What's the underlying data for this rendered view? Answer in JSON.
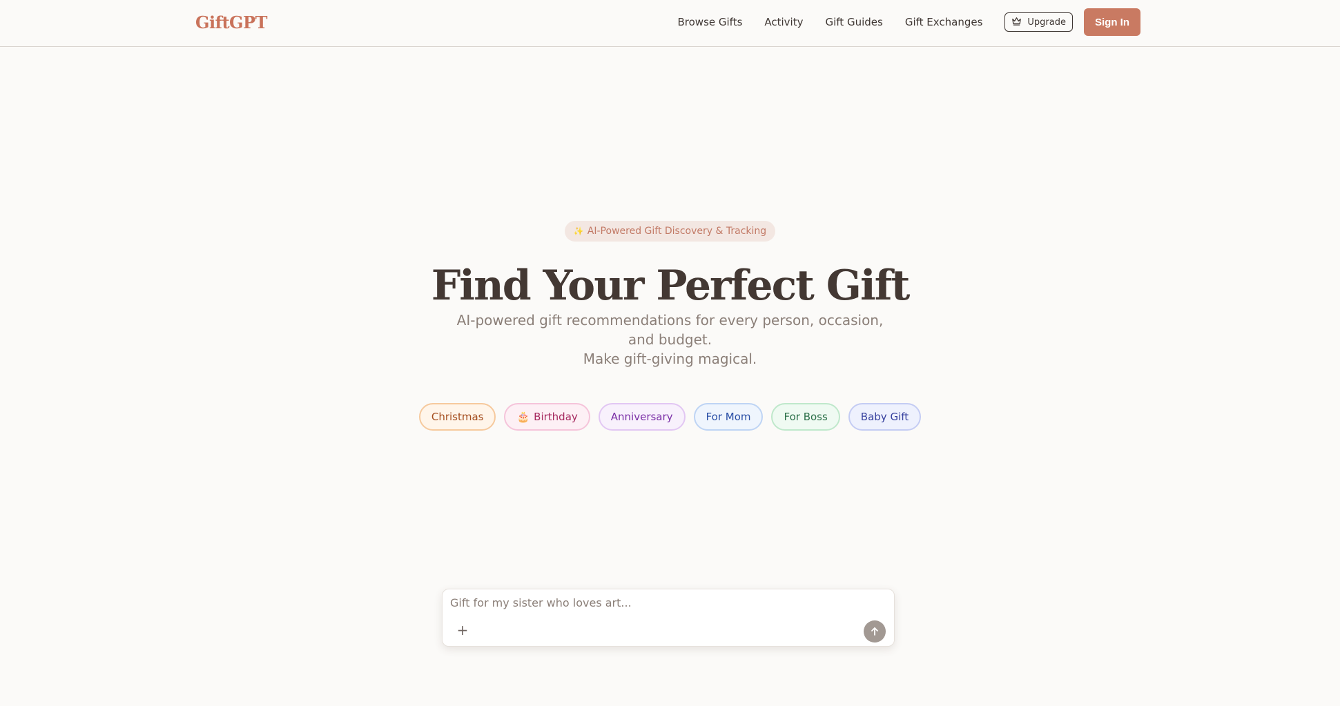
{
  "brand": {
    "name": "GiftGPT",
    "color": "#c9725a"
  },
  "nav": {
    "links": [
      "Browse Gifts",
      "Activity",
      "Gift Guides",
      "Gift Exchanges"
    ],
    "upgrade_label": "Upgrade",
    "upgrade_icon": "crown-icon",
    "signin_label": "Sign In"
  },
  "hero": {
    "badge_icon": "sparkle-icon",
    "badge_label": "AI-Powered Gift Discovery & Tracking",
    "title": "Find Your Perfect Gift",
    "subtitle_line1": "AI-powered gift recommendations for every person, occasion, and budget.",
    "subtitle_line2": "Make gift-giving magical."
  },
  "chips": [
    {
      "label": "Christmas"
    },
    {
      "label": "Birthday",
      "icon": "cake-icon"
    },
    {
      "label": "Anniversary"
    },
    {
      "label": "For Mom"
    },
    {
      "label": "For Boss"
    },
    {
      "label": "Baby Gift"
    }
  ],
  "composer": {
    "placeholder": "Gift for my sister who loves art...",
    "add_icon": "plus-icon",
    "send_icon": "arrow-up-icon"
  },
  "colors": {
    "background": "#fbfaf8",
    "accent": "#c97a62",
    "text": "#3f3733",
    "muted": "#8b7f78"
  }
}
